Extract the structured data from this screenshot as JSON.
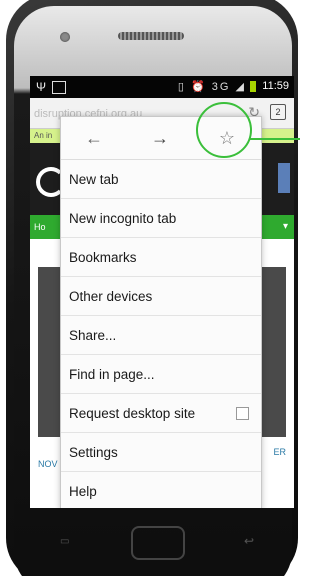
{
  "status_bar": {
    "time": "11:59",
    "signal_label": "3G"
  },
  "browser": {
    "url": "disruption.cefni.org.au",
    "tab_count": "2"
  },
  "page": {
    "banner_text": "An in",
    "greenbar_text": "Ho",
    "bottom_left": "NOV",
    "bottom_right": "ER"
  },
  "menu": {
    "nav": {
      "back_icon": "←",
      "forward_icon": "→",
      "bookmark_icon": "☆"
    },
    "items": [
      {
        "label": "New tab"
      },
      {
        "label": "New incognito tab"
      },
      {
        "label": "Bookmarks"
      },
      {
        "label": "Other devices"
      },
      {
        "label": "Share..."
      },
      {
        "label": "Find in page..."
      },
      {
        "label": "Request desktop site",
        "checkbox": false
      },
      {
        "label": "Settings"
      },
      {
        "label": "Help"
      }
    ]
  },
  "colors": {
    "accent": "#3bbf3b",
    "site_green": "#2faa2f",
    "battery": "#a6d300"
  }
}
